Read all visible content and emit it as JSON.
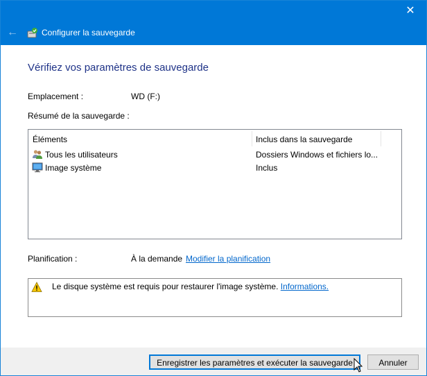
{
  "window": {
    "close_label": "✕"
  },
  "nav": {
    "back_label": "←",
    "title": "Configurer la sauvegarde"
  },
  "page": {
    "heading": "Vérifiez vos paramètres de sauvegarde"
  },
  "location": {
    "label": "Emplacement :",
    "value": "WD (F:)"
  },
  "summary": {
    "label": "Résumé de la sauvegarde :",
    "columns": [
      "Éléments",
      "Inclus dans la sauvegarde"
    ],
    "rows": [
      {
        "name": "Tous les utilisateurs",
        "included": "Dossiers Windows et fichiers lo...",
        "icon": "users-icon"
      },
      {
        "name": "Image système",
        "included": "Inclus",
        "icon": "monitor-icon"
      }
    ]
  },
  "schedule": {
    "label": "Planification :",
    "value": "À la demande",
    "link": "Modifier la planification"
  },
  "notice": {
    "text": "Le disque système est requis pour restaurer l'image système.",
    "link": "Informations.",
    "icon": "warning-icon"
  },
  "buttons": {
    "save": "Enregistrer les paramètres et exécuter la sauvegarde",
    "cancel": "Annuler"
  },
  "colors": {
    "titlebar": "#0078d7",
    "heading": "#1e3287",
    "link": "#0066cc",
    "warning": "#f6c600"
  }
}
